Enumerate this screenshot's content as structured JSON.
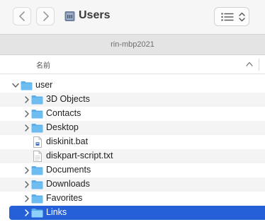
{
  "window": {
    "title": "Users",
    "path_bar": "rin-mbp2021"
  },
  "toolbar": {
    "back_icon": "chevron-left-icon",
    "forward_icon": "chevron-right-icon",
    "folder_icon": "user-folder-icon",
    "view_icon": "list-view-icon"
  },
  "columns": {
    "name": "名前"
  },
  "tree": {
    "root": "user",
    "items": [
      {
        "label": "3D Objects",
        "kind": "folder",
        "expandable": true
      },
      {
        "label": "Contacts",
        "kind": "folder",
        "expandable": true
      },
      {
        "label": "Desktop",
        "kind": "folder",
        "expandable": true
      },
      {
        "label": "diskinit.bat",
        "kind": "file-bat",
        "expandable": false
      },
      {
        "label": "diskpart-script.txt",
        "kind": "file-txt",
        "expandable": false
      },
      {
        "label": "Documents",
        "kind": "folder",
        "expandable": true
      },
      {
        "label": "Downloads",
        "kind": "folder",
        "expandable": true
      },
      {
        "label": "Favorites",
        "kind": "folder",
        "expandable": true
      },
      {
        "label": "Links",
        "kind": "folder",
        "expandable": true,
        "selected": true
      }
    ]
  },
  "colors": {
    "folder": "#5aaee8",
    "selection": "#2660d8"
  }
}
